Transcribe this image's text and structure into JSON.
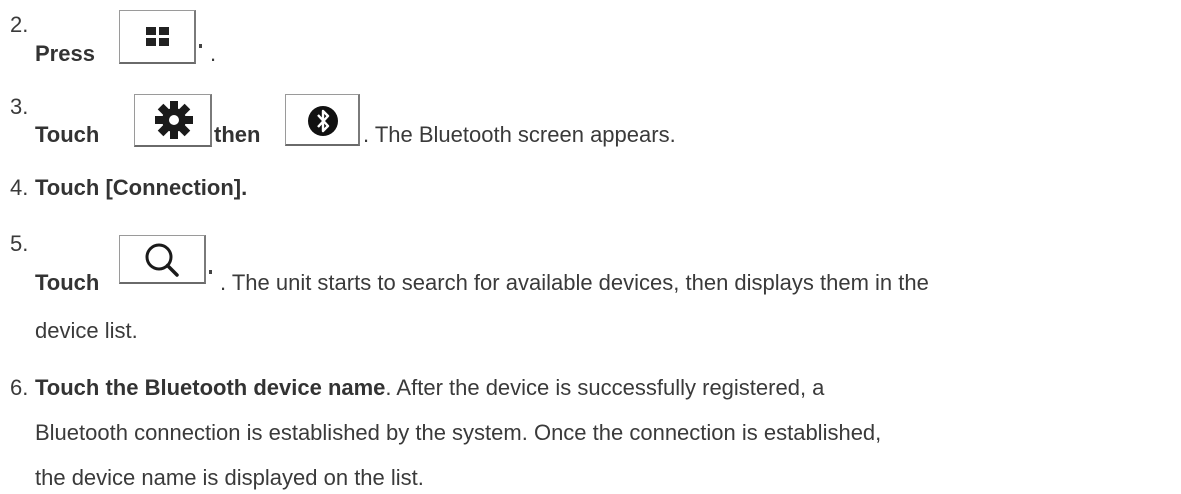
{
  "steps": [
    {
      "num": "2.",
      "bold": "Press",
      "after": "."
    },
    {
      "num": "3.",
      "bold_a": "Touch",
      "bold_b": "then",
      "after": ". The Bluetooth screen appears."
    },
    {
      "num": "4.",
      "bold": "Touch [Connection]."
    },
    {
      "num": "5.",
      "bold": "Touch",
      "after": ". The unit starts to search for available devices, then displays them in the",
      "line2": "device list."
    },
    {
      "num": "6.",
      "bold": "Touch the Bluetooth device name",
      "after": ". After the device is successfully registered, a",
      "line2": "Bluetooth connection is established by the system. Once the connection is established,",
      "line3": "the device name is displayed on the list."
    }
  ],
  "icons": {
    "home": "grid-icon",
    "settings": "gear-icon",
    "bluetooth": "bluetooth-icon",
    "search": "search-icon"
  }
}
